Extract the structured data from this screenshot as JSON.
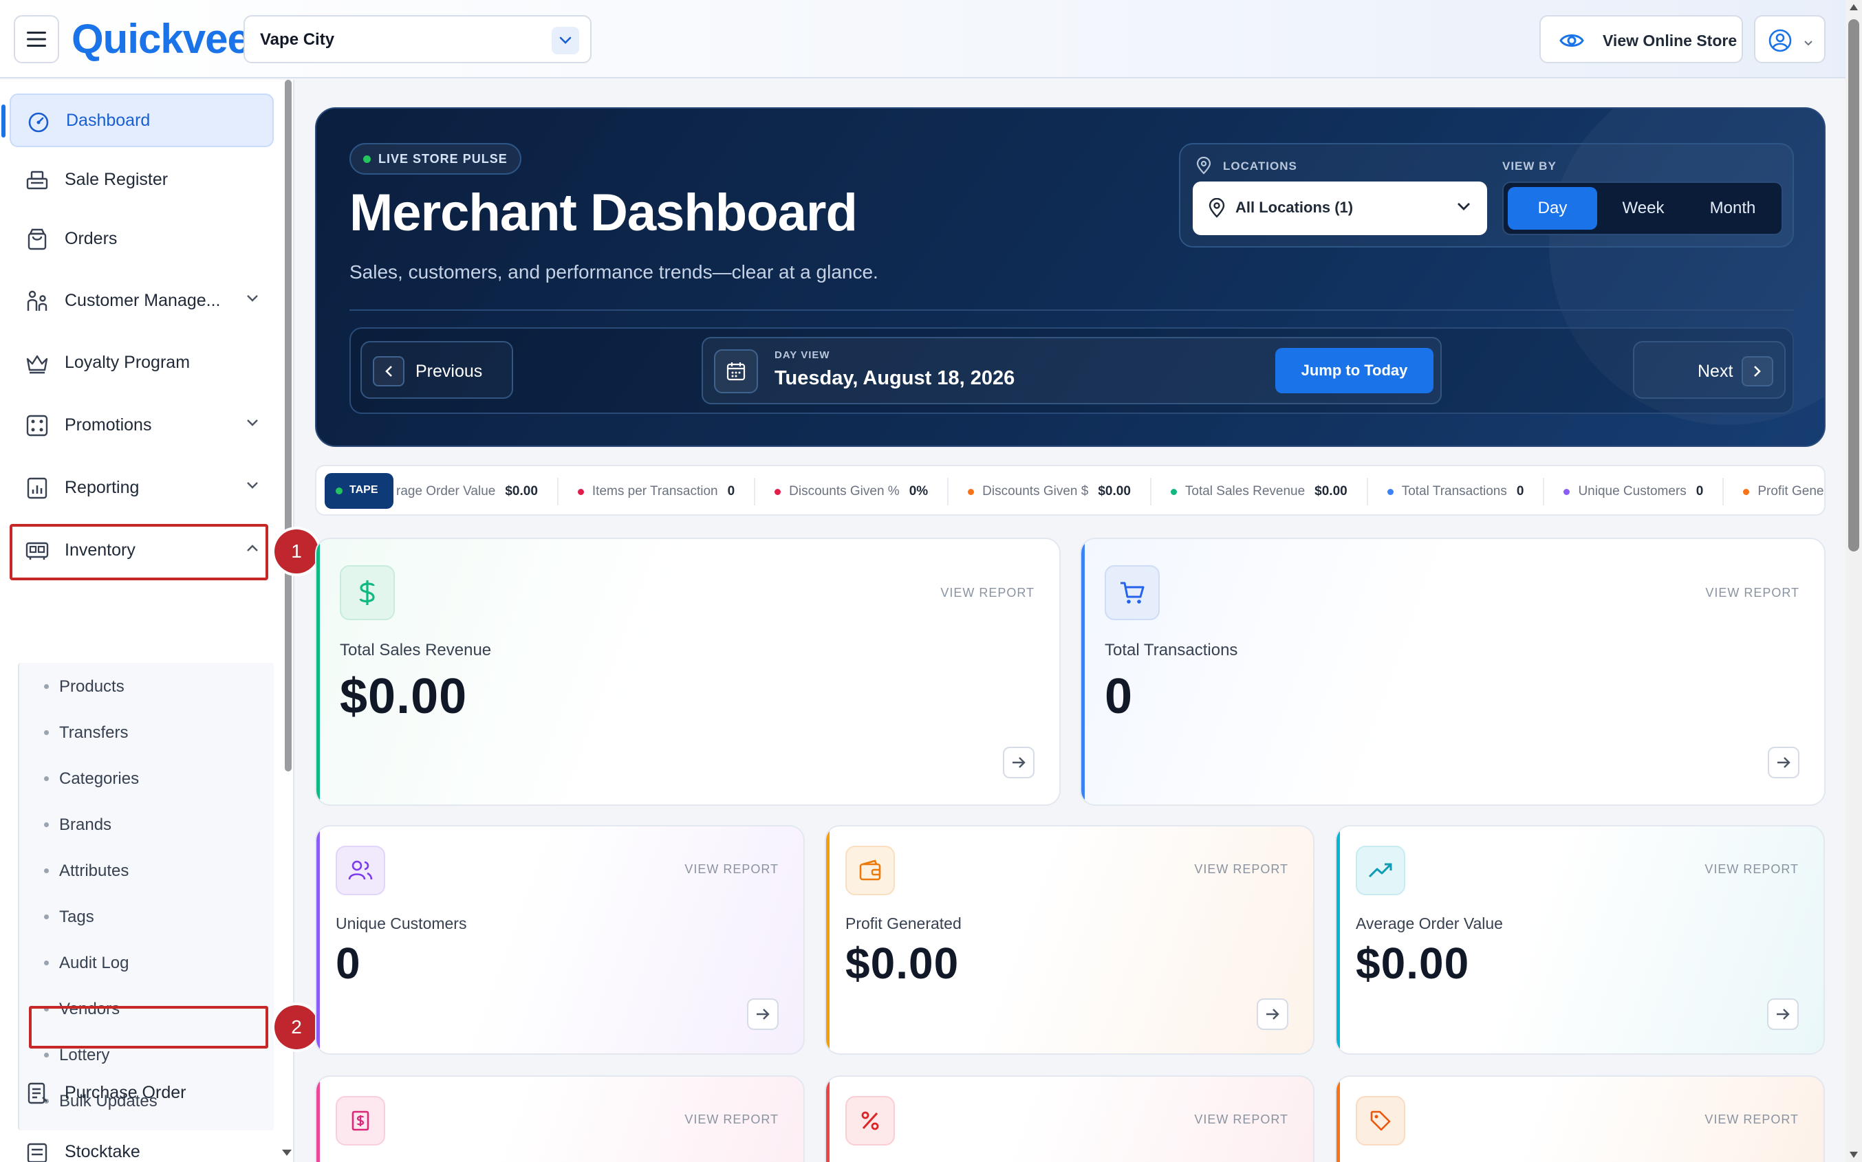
{
  "header": {
    "logo": "Quickvee",
    "store": "Vape City",
    "view_store": "View Online Store"
  },
  "sidebar": {
    "items": [
      {
        "label": "Dashboard",
        "icon": "dashboard-gauge-icon"
      },
      {
        "label": "Sale Register",
        "icon": "register-icon"
      },
      {
        "label": "Orders",
        "icon": "bag-icon"
      },
      {
        "label": "Customer Manage...",
        "icon": "customers-icon"
      },
      {
        "label": "Loyalty Program",
        "icon": "crown-icon"
      },
      {
        "label": "Promotions",
        "icon": "promotions-icon"
      },
      {
        "label": "Reporting",
        "icon": "report-icon"
      },
      {
        "label": "Inventory",
        "icon": "inventory-icon"
      },
      {
        "label": "Purchase Order",
        "icon": "purchase-order-icon"
      },
      {
        "label": "Stocktake",
        "icon": "stocktake-icon"
      }
    ],
    "inventory_sub": [
      "Products",
      "Transfers",
      "Categories",
      "Brands",
      "Attributes",
      "Tags",
      "Audit Log",
      "Vendors",
      "Lottery",
      "Bulk Updates"
    ]
  },
  "annotations": {
    "first": "1",
    "second": "2"
  },
  "hero": {
    "badge": "LIVE STORE PULSE",
    "title": "Merchant Dashboard",
    "subtitle": "Sales, customers, and performance trends—clear at a glance.",
    "locations_caption": "LOCATIONS",
    "location_value": "All Locations (1)",
    "viewby_caption": "VIEW BY",
    "viewby_options": [
      "Day",
      "Week",
      "Month"
    ],
    "viewby_selected": "Day",
    "previous": "Previous",
    "next": "Next",
    "dayview_caption": "DAY VIEW",
    "date": "Tuesday, August 18, 2026",
    "jump": "Jump to Today"
  },
  "tape": {
    "tag": "TAPE",
    "items": [
      {
        "label": "rage Order Value",
        "value": "$0.00",
        "color": "#9aa3af"
      },
      {
        "label": "Items per Transaction",
        "value": "0",
        "color": "#e11d48"
      },
      {
        "label": "Discounts Given %",
        "value": "0%",
        "color": "#e11d48"
      },
      {
        "label": "Discounts Given $",
        "value": "$0.00",
        "color": "#f97316"
      },
      {
        "label": "Total Sales Revenue",
        "value": "$0.00",
        "color": "#10b981"
      },
      {
        "label": "Total Transactions",
        "value": "0",
        "color": "#3b82f6"
      },
      {
        "label": "Unique Customers",
        "value": "0",
        "color": "#8b5cf6"
      },
      {
        "label": "Profit Genera",
        "value": "",
        "color": "#f97316"
      }
    ]
  },
  "cards": {
    "view_report": "VIEW REPORT",
    "revenue": {
      "title": "Total Sales Revenue",
      "value": "$0.00"
    },
    "transactions": {
      "title": "Total Transactions",
      "value": "0"
    },
    "customers": {
      "title": "Unique Customers",
      "value": "0"
    },
    "profit": {
      "title": "Profit Generated",
      "value": "$0.00"
    },
    "aov": {
      "title": "Average Order Value",
      "value": "$0.00"
    }
  }
}
